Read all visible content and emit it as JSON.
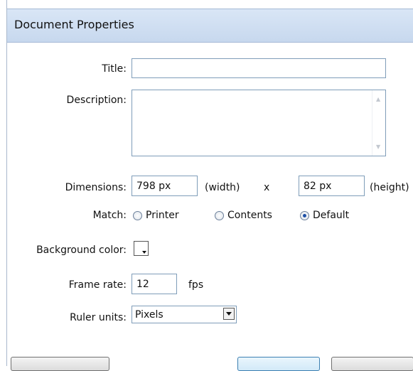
{
  "window": {
    "title": "Document Properties"
  },
  "form": {
    "title_label": "Title:",
    "title_value": "",
    "description_label": "Description:",
    "description_value": "",
    "dimensions_label": "Dimensions:",
    "width_value": "798 px",
    "width_unit_label": "(width)",
    "times_label": "x",
    "height_value": "82 px",
    "height_unit_label": "(height)",
    "match_label": "Match:",
    "match_options": [
      {
        "label": "Printer",
        "checked": false
      },
      {
        "label": "Contents",
        "checked": false
      },
      {
        "label": "Default",
        "checked": true
      }
    ],
    "background_color_label": "Background color:",
    "background_color": "#ffffff",
    "frame_rate_label": "Frame rate:",
    "frame_rate_value": "12",
    "fps_label": "fps",
    "ruler_units_label": "Ruler units:",
    "ruler_units_value": "Pixels"
  },
  "icons": {
    "scroll_up": "scroll-up-arrow-icon",
    "scroll_down": "scroll-down-arrow-icon",
    "dropdown": "dropdown-arrow-icon"
  }
}
